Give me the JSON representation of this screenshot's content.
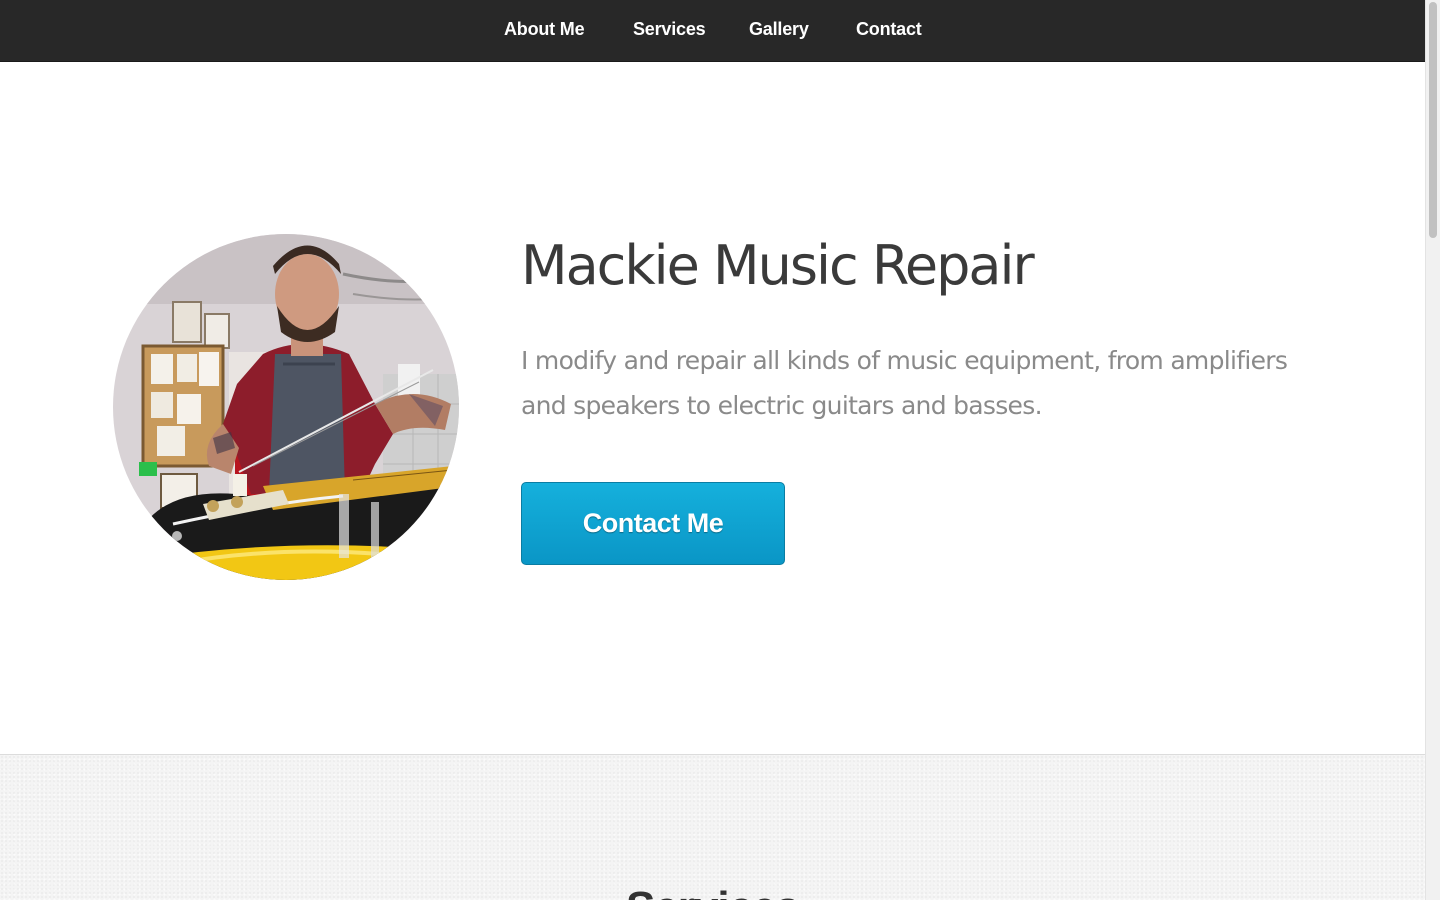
{
  "nav": {
    "items": [
      {
        "label": "About Me"
      },
      {
        "label": "Services"
      },
      {
        "label": "Gallery"
      },
      {
        "label": "Contact"
      }
    ]
  },
  "hero": {
    "title": "Mackie Music Repair",
    "description": "I modify and repair all kinds of music equipment, from amplifiers and speakers to electric guitars and basses.",
    "cta_label": "Contact Me",
    "photo_icon": "portrait-photo-icon"
  },
  "services": {
    "heading": "Services"
  },
  "colors": {
    "nav_bg": "#282828",
    "accent": "#0a96c6",
    "title": "#3a3a3a",
    "body_text": "#8a8a8a"
  }
}
